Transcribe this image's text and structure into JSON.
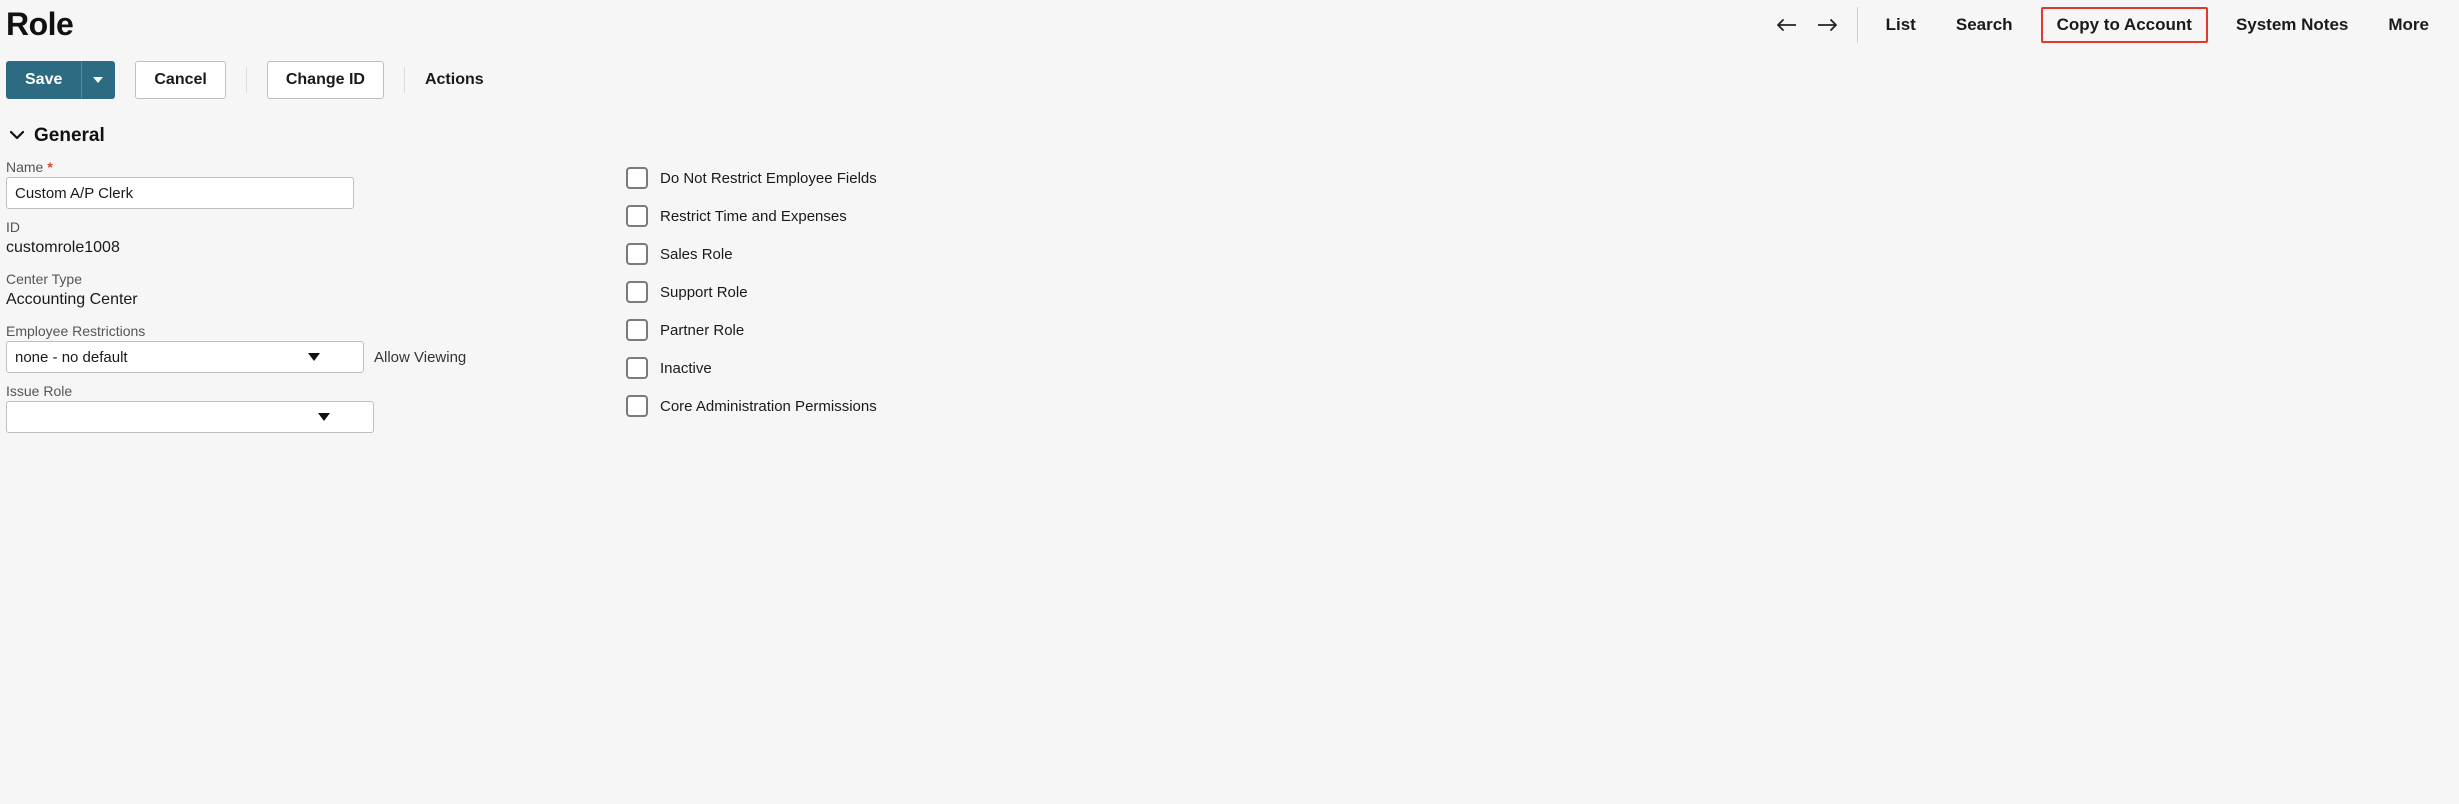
{
  "page_title": "Role",
  "header_nav": {
    "list": "List",
    "search": "Search",
    "copy_to_account": "Copy to Account",
    "system_notes": "System Notes",
    "more": "More"
  },
  "toolbar": {
    "save": "Save",
    "cancel": "Cancel",
    "change_id": "Change ID",
    "actions": "Actions"
  },
  "section": {
    "general_title": "General"
  },
  "fields": {
    "name_label": "Name",
    "name_value": "Custom A/P Clerk",
    "id_label": "ID",
    "id_value": "customrole1008",
    "center_type_label": "Center Type",
    "center_type_value": "Accounting Center",
    "employee_restrictions_label": "Employee Restrictions",
    "employee_restrictions_value": "none - no default",
    "allow_viewing_label": "Allow Viewing",
    "issue_role_label": "Issue Role",
    "issue_role_value": ""
  },
  "checkboxes": {
    "do_not_restrict": "Do Not Restrict Employee Fields",
    "restrict_time": "Restrict Time and Expenses",
    "sales_role": "Sales Role",
    "support_role": "Support Role",
    "partner_role": "Partner Role",
    "inactive": "Inactive",
    "core_admin": "Core Administration Permissions"
  }
}
